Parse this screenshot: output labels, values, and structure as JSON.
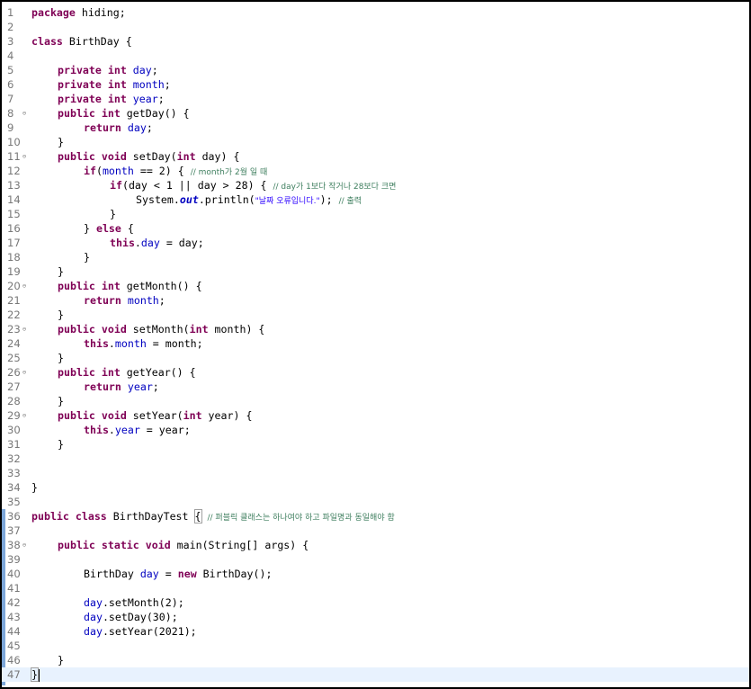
{
  "editor": {
    "current_line": 47,
    "lines": [
      {
        "n": "1"
      },
      {
        "n": "2"
      },
      {
        "n": "3"
      },
      {
        "n": "4"
      },
      {
        "n": "5"
      },
      {
        "n": "6"
      },
      {
        "n": "7"
      },
      {
        "n": "8"
      },
      {
        "n": "9"
      },
      {
        "n": "10"
      },
      {
        "n": "11"
      },
      {
        "n": "12"
      },
      {
        "n": "13"
      },
      {
        "n": "14"
      },
      {
        "n": "15"
      },
      {
        "n": "16"
      },
      {
        "n": "17"
      },
      {
        "n": "18"
      },
      {
        "n": "19"
      },
      {
        "n": "20"
      },
      {
        "n": "21"
      },
      {
        "n": "22"
      },
      {
        "n": "23"
      },
      {
        "n": "24"
      },
      {
        "n": "25"
      },
      {
        "n": "26"
      },
      {
        "n": "27"
      },
      {
        "n": "28"
      },
      {
        "n": "29"
      },
      {
        "n": "30"
      },
      {
        "n": "31"
      },
      {
        "n": "32"
      },
      {
        "n": "33"
      },
      {
        "n": "34"
      },
      {
        "n": "35"
      },
      {
        "n": "36"
      },
      {
        "n": "37"
      },
      {
        "n": "38"
      },
      {
        "n": "39"
      },
      {
        "n": "40"
      },
      {
        "n": "41"
      },
      {
        "n": "42"
      },
      {
        "n": "43"
      },
      {
        "n": "44"
      },
      {
        "n": "45"
      },
      {
        "n": "46"
      },
      {
        "n": "47"
      }
    ],
    "tokens": {
      "package": "package",
      "hiding": " hiding;",
      "class_kw": "class",
      "birthday_decl": " BirthDay {",
      "private": "private",
      "int": "int",
      "public": "public",
      "void": "void",
      "return": "return",
      "if": "if",
      "else": "else",
      "this": "this",
      "new": "new",
      "static": "static",
      "day": "day",
      "month": "month",
      "year": "year",
      "semi": ";",
      "getDay": " getDay() {",
      "setDay_open": " setDay(",
      "setDay_param": " day) {",
      "close": "}",
      "if_month_open": "(",
      "if_month_rest": " == 2) { ",
      "c11": "// month가 2월 일 때",
      "if_day_open": "(day < 1 || day > 28) { ",
      "c13": "// day가 1보다 작거나 28보다 크면",
      "system": "System.",
      "out": "out",
      "println_open": ".println(",
      "str14": "\"날짜 오류입니다.\"",
      "println_close": "); ",
      "c14": "// 출력",
      "else_close": "} ",
      "else_open": " {",
      "dot": ".",
      "assign_day": " = day;",
      "assign_month": " = month;",
      "assign_year": " = year;",
      "getMonth": " getMonth() {",
      "setMonth_open": " setMonth(",
      "setMonth_param": " month) {",
      "getYear": " getYear() {",
      "setYear_open": " setYear(",
      "setYear_param": " year) {",
      "test_decl": " BirthDayTest ",
      "brace_open": "{",
      "c36": "// 퍼블릭 클래스는 하나여야 하고 파일명과 동일해야 함",
      "main_sig": " main(String[] args) {",
      "bd_type": "BirthDay ",
      "new_rest": " BirthDay();",
      "assign_eq": " = ",
      "call_month": ".setMonth(2);",
      "call_day": ".setDay(30);",
      "call_year": ".setYear(2021);"
    }
  }
}
